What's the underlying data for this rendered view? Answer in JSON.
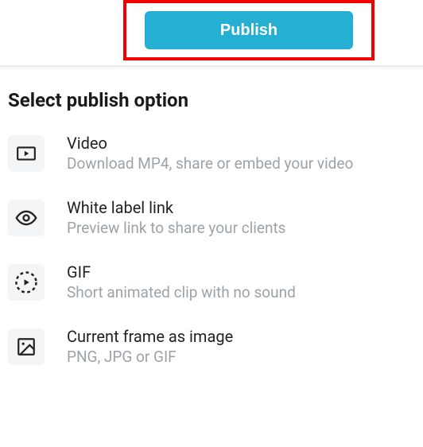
{
  "header": {
    "publish_label": "Publish"
  },
  "section_title": "Select publish option",
  "options": [
    {
      "title": "Video",
      "desc": "Download MP4, share or embed your video"
    },
    {
      "title": "White label link",
      "desc": "Preview link to share your clients"
    },
    {
      "title": "GIF",
      "desc": "Short animated clip with no sound"
    },
    {
      "title": "Current frame as image",
      "desc": "PNG, JPG or GIF"
    }
  ]
}
